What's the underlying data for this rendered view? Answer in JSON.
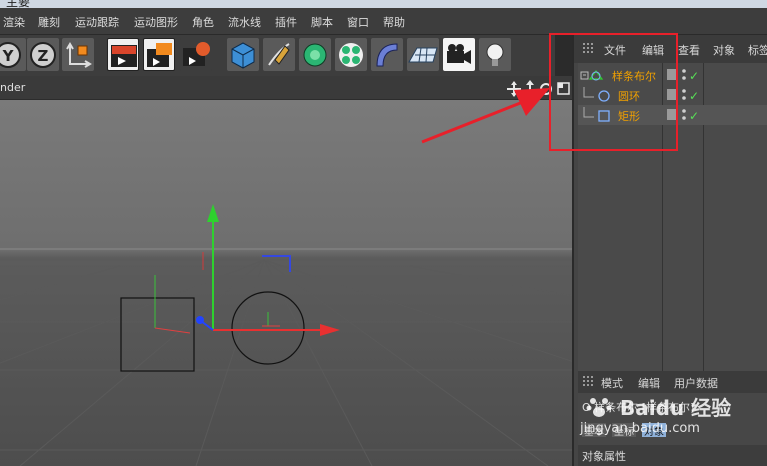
{
  "window": {
    "title": "主要"
  },
  "menu": {
    "items": [
      "渲染",
      "雕刻",
      "运动跟踪",
      "运动图形",
      "角色",
      "流水线",
      "插件",
      "脚本",
      "窗口",
      "帮助"
    ]
  },
  "toolbar": {
    "icons": [
      "y-axis-lock-icon",
      "z-axis-lock-icon",
      "world-coordinate-icon",
      "render-view-icon",
      "render-picture-queue-icon",
      "render-settings-icon",
      "cube-primitive-icon",
      "spline-pen-icon",
      "nurbs-generator-icon",
      "mograph-cloner-icon",
      "deformer-bend-icon",
      "floor-environment-icon",
      "camera-icon",
      "light-icon"
    ],
    "labels": {
      "y": "Y",
      "z": "Z"
    }
  },
  "viewport": {
    "label": "nder",
    "nav_icons": [
      "move-view-icon",
      "zoom-view-icon",
      "rotate-view-icon",
      "maximize-view-icon"
    ]
  },
  "object_manager": {
    "menu": [
      "文件",
      "编辑",
      "查看",
      "对象",
      "标签"
    ],
    "objects": [
      {
        "name": "样条布尔",
        "icon": "spline-boolean-icon",
        "indent": 0
      },
      {
        "name": "圆环",
        "icon": "circle-spline-icon",
        "indent": 1
      },
      {
        "name": "矩形",
        "icon": "rectangle-spline-icon",
        "indent": 1
      }
    ],
    "check": "✓"
  },
  "attributes": {
    "menu": [
      "模式",
      "编辑",
      "用户数据"
    ],
    "object_line": "O 样条布尔 [样条布尔]",
    "tabs": [
      "基本",
      "坐标",
      "对象"
    ],
    "active_tab": "对象",
    "section": "对象属性"
  },
  "watermark": {
    "brand": "Baidu 经验",
    "url": "jingyan.baidu.com"
  },
  "colors": {
    "accent_red": "#e8202a",
    "object_name": "#f0a000",
    "spline_blue": "#7fb0ff"
  }
}
